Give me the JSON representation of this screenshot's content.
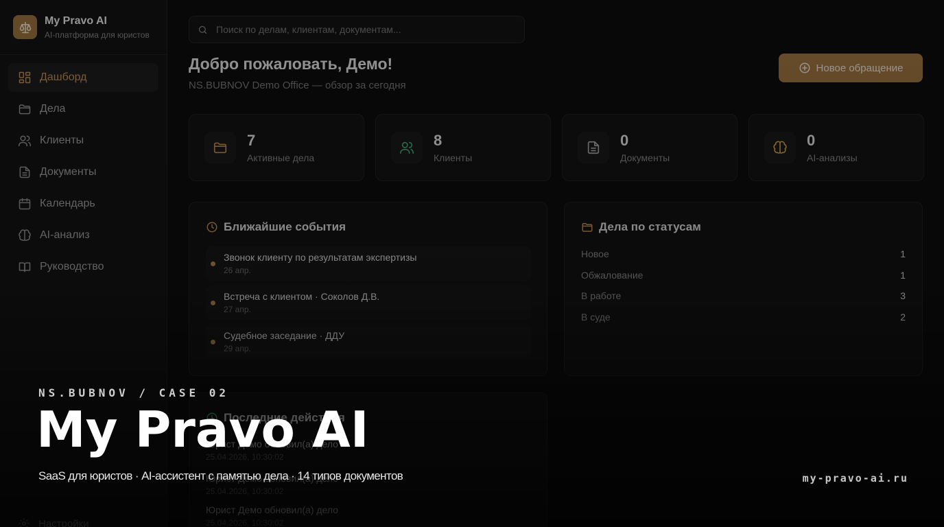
{
  "brand": {
    "name": "My Pravo AI",
    "subtitle": "AI-платформа для юристов"
  },
  "sidebar": {
    "items": [
      {
        "label": "Дашборд",
        "icon": "dashboard-icon",
        "active": true
      },
      {
        "label": "Дела",
        "icon": "folder-icon"
      },
      {
        "label": "Клиенты",
        "icon": "users-icon"
      },
      {
        "label": "Документы",
        "icon": "document-icon"
      },
      {
        "label": "Календарь",
        "icon": "calendar-icon"
      },
      {
        "label": "AI-анализ",
        "icon": "brain-icon"
      },
      {
        "label": "Руководство",
        "icon": "book-icon"
      }
    ],
    "settings_label": "Настройки"
  },
  "search": {
    "placeholder": "Поиск по делам, клиентам, документам...",
    "value": ""
  },
  "welcome": {
    "title": "Добро пожаловать, Демо!",
    "subtitle": "NS.BUBNOV Demo Office — обзор за сегодня"
  },
  "new_request_label": "Новое обращение",
  "stats": [
    {
      "value": "7",
      "label": "Активные дела",
      "icon": "folder-icon",
      "color": "#c9965a"
    },
    {
      "value": "8",
      "label": "Клиенты",
      "icon": "users-icon",
      "color": "#3fb07a"
    },
    {
      "value": "0",
      "label": "Документы",
      "icon": "document-icon",
      "color": "#b0b0b0"
    },
    {
      "value": "0",
      "label": "AI-анализы",
      "icon": "brain-icon",
      "color": "#d9a640"
    }
  ],
  "events": {
    "title": "Ближайшие события",
    "items": [
      {
        "title": "Звонок клиенту по результатам экспертизы",
        "date": "26 апр."
      },
      {
        "title": "Встреча с клиентом · Соколов Д.В.",
        "date": "27 апр."
      },
      {
        "title": "Судебное заседание · ДДУ",
        "date": "29 апр."
      }
    ]
  },
  "statuses": {
    "title": "Дела по статусам",
    "items": [
      {
        "name": "Новое",
        "count": "1"
      },
      {
        "name": "Обжалование",
        "count": "1"
      },
      {
        "name": "В работе",
        "count": "3"
      },
      {
        "name": "В суде",
        "count": "2"
      }
    ]
  },
  "activity": {
    "title": "Последние действия",
    "items": [
      {
        "title": "Юрист Демо обновил(а) дело",
        "date": "25.04.2026, 10:30:02"
      },
      {
        "title": "Юрист Демо обновил(а) дело",
        "date": "25.04.2026, 10:30:02"
      },
      {
        "title": "Юрист Демо обновил(а) дело",
        "date": "25.04.2026, 10:30:02"
      }
    ]
  },
  "overlay": {
    "eyebrow": "NS.BUBNOV / CASE 02",
    "title": "My Pravo AI",
    "subtitle": "SaaS для юристов · AI-ассистент с памятью дела · 14 типов документов",
    "url": "my-pravo-ai.ru"
  },
  "colors": {
    "accent": "#a57a44",
    "accent_text": "#c9965a",
    "background": "#0d0d0d",
    "panel": "#131313"
  }
}
